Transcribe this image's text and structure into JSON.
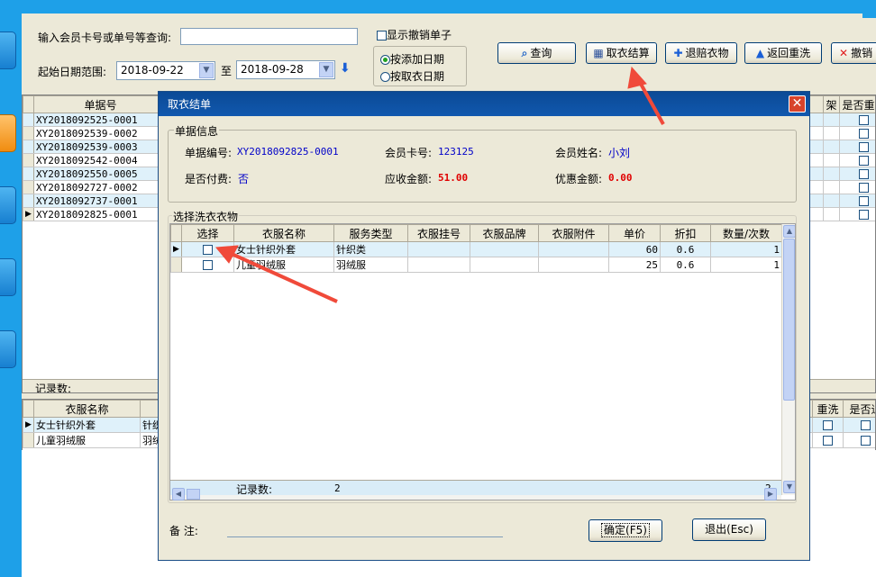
{
  "search": {
    "label": "输入会员卡号或单号等查询:",
    "value": "",
    "show_cancelled": "显示撤销单子",
    "date_label": "起始日期范围:",
    "date_from": "2018-09-22",
    "to_label": "至",
    "date_to": "2018-09-28",
    "radio_add": "按添加日期",
    "radio_pick": "按取衣日期"
  },
  "toolbar": {
    "query": "查询",
    "pickup": "取衣结算",
    "refund": "退赔衣物",
    "rewash": "返回重洗",
    "cancel": "撤销"
  },
  "main_table": {
    "header": "单据号",
    "right_header_1": "架",
    "right_header_2": "是否重洗",
    "rows": [
      "XY2018092525-0001",
      "XY2018092539-0002",
      "XY2018092539-0003",
      "XY2018092542-0004",
      "XY2018092550-0005",
      "XY2018092727-0002",
      "XY2018092737-0001",
      "XY2018092825-0001"
    ],
    "record_label": "记录数:"
  },
  "lower_table": {
    "header": "衣服名称",
    "right_header_1": "重洗",
    "right_header_2": "是否退",
    "rows": [
      {
        "name": "女士针织外套",
        "type": "针织"
      },
      {
        "name": "儿童羽绒服",
        "type": "羽绒"
      }
    ]
  },
  "dialog": {
    "title": "取衣结单",
    "info_title": "单据信息",
    "doc_no_label": "单据编号:",
    "doc_no": "XY2018092825-0001",
    "card_label": "会员卡号:",
    "card": "123125",
    "name_label": "会员姓名:",
    "name": "小刘",
    "paid_label": "是否付费:",
    "paid": "否",
    "due_label": "应收金额:",
    "due": "51.00",
    "discount_label": "优惠金额:",
    "discount": "0.00",
    "items_title": "选择洗衣衣物",
    "columns": [
      "选择",
      "衣服名称",
      "服务类型",
      "衣服挂号",
      "衣服品牌",
      "衣服附件",
      "单价",
      "折扣",
      "数量/次数"
    ],
    "items": [
      {
        "name": "女士针织外套",
        "service": "针织类",
        "price": "60",
        "discount": "0.6",
        "qty": "1"
      },
      {
        "name": "儿童羽绒服",
        "service": "羽绒服",
        "price": "25",
        "discount": "0.6",
        "qty": "1"
      }
    ],
    "record_label": "记录数:",
    "record_count": "2",
    "qty_total": "2",
    "note_label": "备    注:",
    "ok": "确定(F5)",
    "exit": "退出(Esc)"
  },
  "colors": {
    "accent": "#1ea0e8",
    "title_bar": "#0b4a96",
    "annotation": "#f04a3a"
  }
}
